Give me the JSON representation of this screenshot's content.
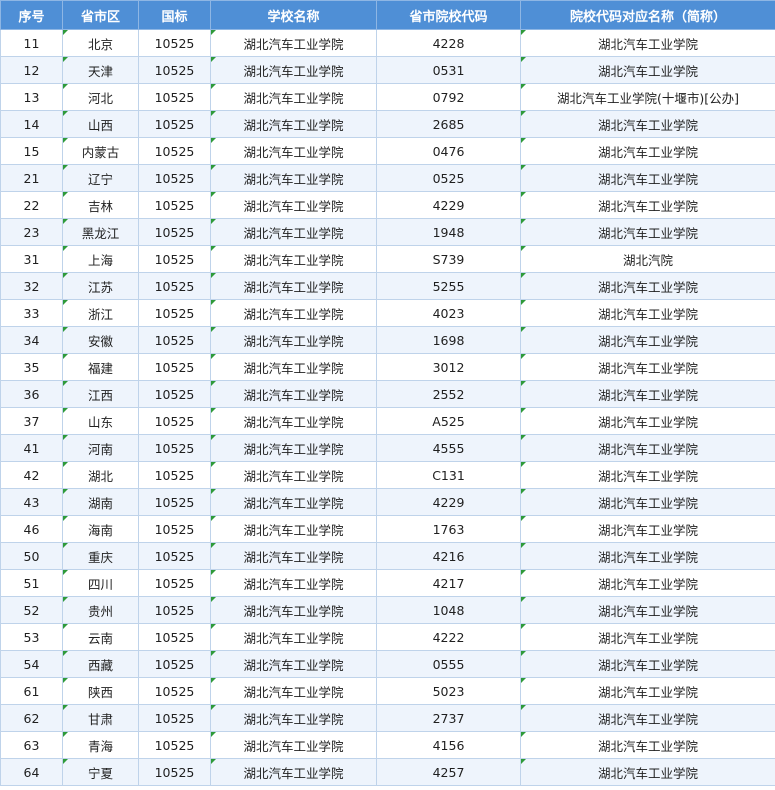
{
  "headers": [
    "序号",
    "省市区",
    "国标",
    "学校名称",
    "省市院校代码",
    "院校代码对应名称（简称）"
  ],
  "rows": [
    [
      "11",
      "北京",
      "10525",
      "湖北汽车工业学院",
      "4228",
      "湖北汽车工业学院"
    ],
    [
      "12",
      "天津",
      "10525",
      "湖北汽车工业学院",
      "0531",
      "湖北汽车工业学院"
    ],
    [
      "13",
      "河北",
      "10525",
      "湖北汽车工业学院",
      "0792",
      "湖北汽车工业学院(十堰市)[公办]"
    ],
    [
      "14",
      "山西",
      "10525",
      "湖北汽车工业学院",
      "2685",
      "湖北汽车工业学院"
    ],
    [
      "15",
      "内蒙古",
      "10525",
      "湖北汽车工业学院",
      "0476",
      "湖北汽车工业学院"
    ],
    [
      "21",
      "辽宁",
      "10525",
      "湖北汽车工业学院",
      "0525",
      "湖北汽车工业学院"
    ],
    [
      "22",
      "吉林",
      "10525",
      "湖北汽车工业学院",
      "4229",
      "湖北汽车工业学院"
    ],
    [
      "23",
      "黑龙江",
      "10525",
      "湖北汽车工业学院",
      "1948",
      "湖北汽车工业学院"
    ],
    [
      "31",
      "上海",
      "10525",
      "湖北汽车工业学院",
      "S739",
      "湖北汽院"
    ],
    [
      "32",
      "江苏",
      "10525",
      "湖北汽车工业学院",
      "5255",
      "湖北汽车工业学院"
    ],
    [
      "33",
      "浙江",
      "10525",
      "湖北汽车工业学院",
      "4023",
      "湖北汽车工业学院"
    ],
    [
      "34",
      "安徽",
      "10525",
      "湖北汽车工业学院",
      "1698",
      "湖北汽车工业学院"
    ],
    [
      "35",
      "福建",
      "10525",
      "湖北汽车工业学院",
      "3012",
      "湖北汽车工业学院"
    ],
    [
      "36",
      "江西",
      "10525",
      "湖北汽车工业学院",
      "2552",
      "湖北汽车工业学院"
    ],
    [
      "37",
      "山东",
      "10525",
      "湖北汽车工业学院",
      "A525",
      "湖北汽车工业学院"
    ],
    [
      "41",
      "河南",
      "10525",
      "湖北汽车工业学院",
      "4555",
      "湖北汽车工业学院"
    ],
    [
      "42",
      "湖北",
      "10525",
      "湖北汽车工业学院",
      "C131",
      "湖北汽车工业学院"
    ],
    [
      "43",
      "湖南",
      "10525",
      "湖北汽车工业学院",
      "4229",
      "湖北汽车工业学院"
    ],
    [
      "46",
      "海南",
      "10525",
      "湖北汽车工业学院",
      "1763",
      "湖北汽车工业学院"
    ],
    [
      "50",
      "重庆",
      "10525",
      "湖北汽车工业学院",
      "4216",
      "湖北汽车工业学院"
    ],
    [
      "51",
      "四川",
      "10525",
      "湖北汽车工业学院",
      "4217",
      "湖北汽车工业学院"
    ],
    [
      "52",
      "贵州",
      "10525",
      "湖北汽车工业学院",
      "1048",
      "湖北汽车工业学院"
    ],
    [
      "53",
      "云南",
      "10525",
      "湖北汽车工业学院",
      "4222",
      "湖北汽车工业学院"
    ],
    [
      "54",
      "西藏",
      "10525",
      "湖北汽车工业学院",
      "0555",
      "湖北汽车工业学院"
    ],
    [
      "61",
      "陕西",
      "10525",
      "湖北汽车工业学院",
      "5023",
      "湖北汽车工业学院"
    ],
    [
      "62",
      "甘肃",
      "10525",
      "湖北汽车工业学院",
      "2737",
      "湖北汽车工业学院"
    ],
    [
      "63",
      "青海",
      "10525",
      "湖北汽车工业学院",
      "4156",
      "湖北汽车工业学院"
    ],
    [
      "64",
      "宁夏",
      "10525",
      "湖北汽车工业学院",
      "4257",
      "湖北汽车工业学院"
    ]
  ],
  "colors": {
    "header_bg": "#4f8fd6",
    "stripe_bg": "#eef4fc",
    "marker": "#2e9a3a"
  }
}
